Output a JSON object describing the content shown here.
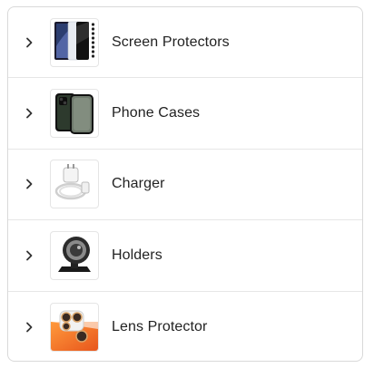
{
  "categories": [
    {
      "label": "Screen Protectors",
      "image": "screen-protector-thumbnail"
    },
    {
      "label": "Phone Cases",
      "image": "phone-case-thumbnail"
    },
    {
      "label": "Charger",
      "image": "charger-thumbnail"
    },
    {
      "label": "Holders",
      "image": "holder-thumbnail"
    },
    {
      "label": "Lens Protector",
      "image": "lens-protector-thumbnail"
    }
  ],
  "icons": {
    "expand": "chevron-right-icon"
  },
  "colors": {
    "text": "#222222",
    "border": "#d9d9d9",
    "chevron": "#333333"
  }
}
